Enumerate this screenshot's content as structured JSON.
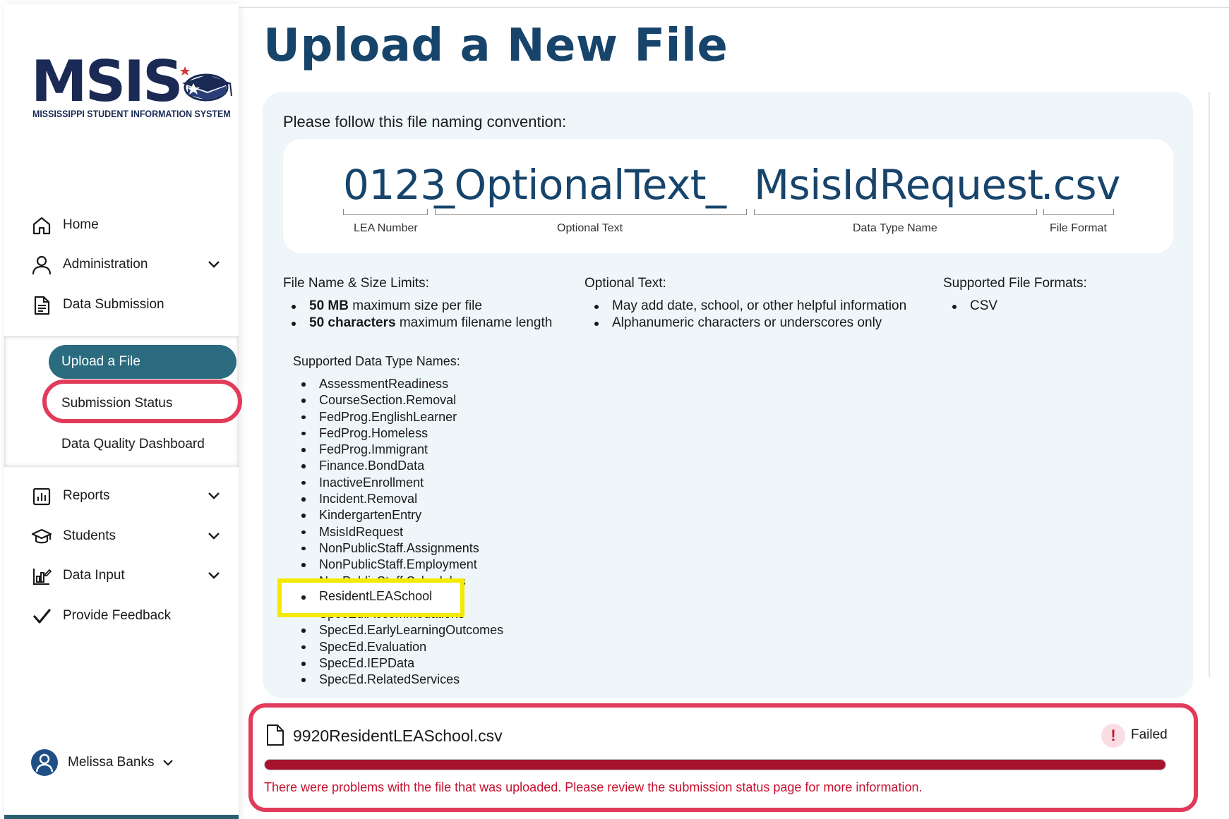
{
  "app": {
    "logo_text": "MSIS",
    "logo_subtitle": "MISSISSIPPI STUDENT INFORMATION SYSTEM"
  },
  "sidebar": {
    "items": [
      {
        "label": "Home",
        "icon": "home-icon",
        "expandable": false
      },
      {
        "label": "Administration",
        "icon": "user-icon",
        "expandable": true
      },
      {
        "label": "Data Submission",
        "icon": "document-icon",
        "expandable": false
      },
      {
        "label": "Reports",
        "icon": "bar-chart-icon",
        "expandable": true
      },
      {
        "label": "Students",
        "icon": "graduation-cap-icon",
        "expandable": true
      },
      {
        "label": "Data Input",
        "icon": "data-input-icon",
        "expandable": true
      },
      {
        "label": "Provide Feedback",
        "icon": "checkmark-icon",
        "expandable": false
      }
    ],
    "submenu": {
      "active": "Upload a File",
      "items": [
        "Submission Status",
        "Data Quality Dashboard"
      ]
    },
    "user": {
      "name": "Melissa Banks"
    }
  },
  "page": {
    "title": "Upload a New File"
  },
  "convention": {
    "label": "Please follow this file naming convention:",
    "parts": [
      {
        "text": "0123",
        "caption": "LEA Number"
      },
      {
        "text": "_OptionalText_",
        "caption": "Optional Text"
      },
      {
        "text": "MsisIdRequest",
        "caption": "Data Type Name"
      },
      {
        "text": ".csv",
        "caption": "File Format"
      }
    ]
  },
  "limits": {
    "heading": "File Name & Size Limits:",
    "items": [
      {
        "bold": "50 MB",
        "rest": " maximum size per file"
      },
      {
        "bold": "50 characters",
        "rest": " maximum filename length"
      }
    ]
  },
  "optional_text": {
    "heading": "Optional Text:",
    "items": [
      "May add date, school, or other helpful information",
      "Alphanumeric characters or underscores only"
    ]
  },
  "formats": {
    "heading": "Supported File Formats:",
    "items": [
      "CSV"
    ]
  },
  "data_types": {
    "heading": "Supported Data Type Names:",
    "items": [
      "AssessmentReadiness",
      "CourseSection.Removal",
      "FedProg.EnglishLearner",
      "FedProg.Homeless",
      "FedProg.Immigrant",
      "Finance.BondData",
      "InactiveEnrollment",
      "Incident.Removal",
      "KindergartenEntry",
      "MsisIdRequest",
      "NonPublicStaff.Assignments",
      "NonPublicStaff.Employment",
      "NonPublicStaff.Schedules",
      "ResidentLEASchool",
      "SpecEd.Accommodations",
      "SpecEd.EarlyLearningOutcomes",
      "SpecEd.Evaluation",
      "SpecEd.IEPData",
      "SpecEd.RelatedServices"
    ],
    "highlighted": "ResidentLEASchool"
  },
  "upload": {
    "file_name": "9920ResidentLEASchool.csv",
    "status": "Failed",
    "progress": 1.0,
    "error_message": "There were problems with the file that was uploaded. Please review the submission status page for more information."
  },
  "colors": {
    "brand_navy": "#1b2a55",
    "title_blue": "#17446b",
    "teal_active": "#2b6b7f",
    "error_red": "#c8102e",
    "annotation_red": "#e23a5a",
    "annotation_yellow": "#f4ea00"
  }
}
